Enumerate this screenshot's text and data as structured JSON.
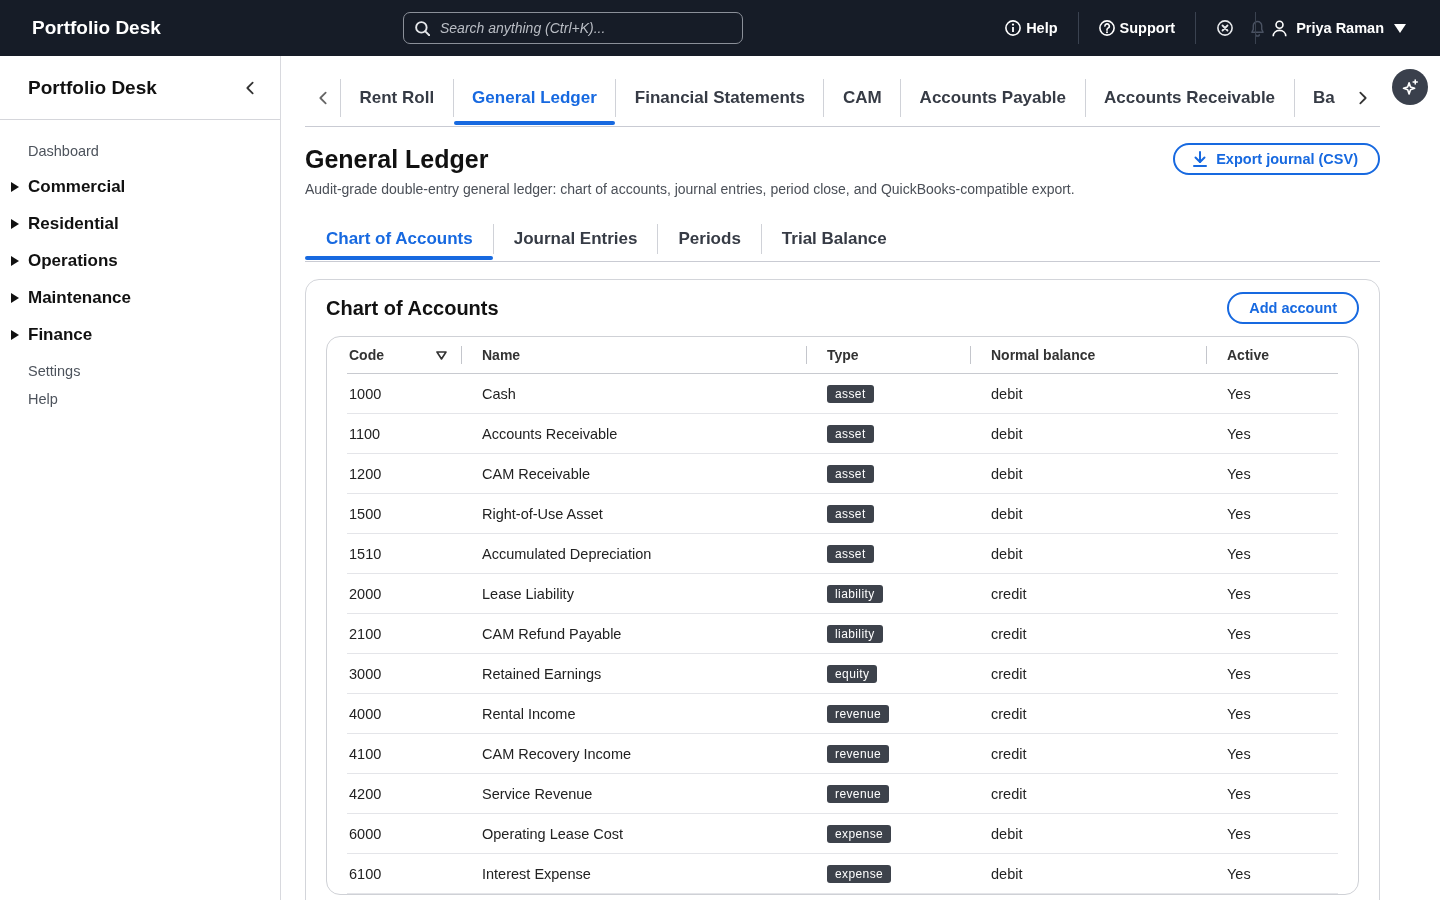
{
  "top_bar": {
    "title": "Portfolio Desk",
    "search": {
      "placeholder": "Search anything (Ctrl+K)..."
    },
    "links": [
      {
        "kind": "info",
        "label": "Help"
      },
      {
        "kind": "question",
        "label": "Support"
      }
    ],
    "user": {
      "name": "Priya Raman"
    }
  },
  "sidebar": {
    "title": "Portfolio Desk",
    "items": [
      {
        "kind": "link",
        "label": "Dashboard"
      },
      {
        "kind": "group",
        "label": "Commercial",
        "expanded": false
      },
      {
        "kind": "group",
        "label": "Residential",
        "expanded": false
      },
      {
        "kind": "group",
        "label": "Operations",
        "expanded": false
      },
      {
        "kind": "group",
        "label": "Maintenance",
        "expanded": false
      },
      {
        "kind": "group",
        "label": "Finance",
        "expanded": false
      },
      {
        "kind": "link",
        "label": "Settings"
      },
      {
        "kind": "link",
        "label": "Help"
      }
    ]
  },
  "module_tabs": [
    {
      "label": "Rent Roll",
      "selected": false
    },
    {
      "label": "General Ledger",
      "selected": true
    },
    {
      "label": "Financial Statements",
      "selected": false
    },
    {
      "label": "CAM",
      "selected": false
    },
    {
      "label": "Accounts Payable",
      "selected": false
    },
    {
      "label": "Accounts Receivable",
      "selected": false
    },
    {
      "label": "Ba",
      "selected": false
    }
  ],
  "page": {
    "title": "General Ledger",
    "description": "Audit-grade double-entry general ledger: chart of accounts, journal entries, period close, and QuickBooks-compatible export.",
    "export_button": "Export journal (CSV)"
  },
  "sub_tabs": [
    {
      "label": "Chart of Accounts",
      "selected": true
    },
    {
      "label": "Journal Entries",
      "selected": false
    },
    {
      "label": "Periods",
      "selected": false
    },
    {
      "label": "Trial Balance",
      "selected": false
    }
  ],
  "chart_of_accounts": {
    "title": "Chart of Accounts",
    "add_button": "Add account",
    "table": {
      "columns": [
        {
          "label": "Code",
          "sortable": true
        },
        {
          "label": "Name",
          "sortable": false
        },
        {
          "label": "Type",
          "sortable": false
        },
        {
          "label": "Normal balance",
          "sortable": false
        },
        {
          "label": "Active",
          "sortable": false
        }
      ],
      "rows": [
        {
          "code": "1000",
          "name": "Cash",
          "type": "asset",
          "normal_balance": "debit",
          "active": "Yes"
        },
        {
          "code": "1100",
          "name": "Accounts Receivable",
          "type": "asset",
          "normal_balance": "debit",
          "active": "Yes"
        },
        {
          "code": "1200",
          "name": "CAM Receivable",
          "type": "asset",
          "normal_balance": "debit",
          "active": "Yes"
        },
        {
          "code": "1500",
          "name": "Right-of-Use Asset",
          "type": "asset",
          "normal_balance": "debit",
          "active": "Yes"
        },
        {
          "code": "1510",
          "name": "Accumulated Depreciation",
          "type": "asset",
          "normal_balance": "debit",
          "active": "Yes"
        },
        {
          "code": "2000",
          "name": "Lease Liability",
          "type": "liability",
          "normal_balance": "credit",
          "active": "Yes"
        },
        {
          "code": "2100",
          "name": "CAM Refund Payable",
          "type": "liability",
          "normal_balance": "credit",
          "active": "Yes"
        },
        {
          "code": "3000",
          "name": "Retained Earnings",
          "type": "equity",
          "normal_balance": "credit",
          "active": "Yes"
        },
        {
          "code": "4000",
          "name": "Rental Income",
          "type": "revenue",
          "normal_balance": "credit",
          "active": "Yes"
        },
        {
          "code": "4100",
          "name": "CAM Recovery Income",
          "type": "revenue",
          "normal_balance": "credit",
          "active": "Yes"
        },
        {
          "code": "4200",
          "name": "Service Revenue",
          "type": "revenue",
          "normal_balance": "credit",
          "active": "Yes"
        },
        {
          "code": "6000",
          "name": "Operating Lease Cost",
          "type": "expense",
          "normal_balance": "debit",
          "active": "Yes"
        },
        {
          "code": "6100",
          "name": "Interest Expense",
          "type": "expense",
          "normal_balance": "debit",
          "active": "Yes"
        }
      ]
    }
  }
}
